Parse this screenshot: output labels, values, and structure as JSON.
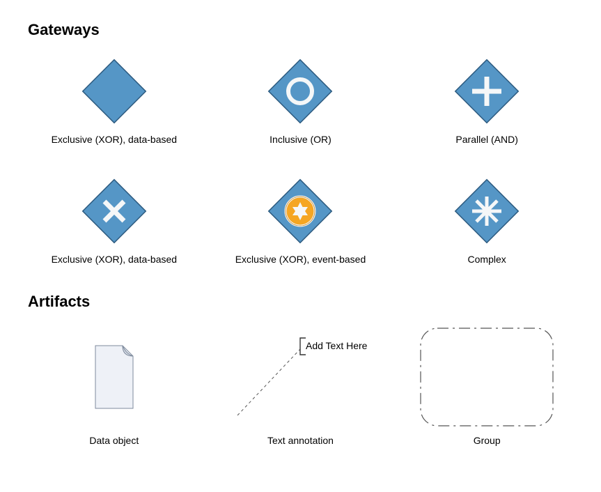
{
  "sections": {
    "gateways": {
      "title": "Gateways",
      "items": [
        {
          "label": "Exclusive (XOR), data-based"
        },
        {
          "label": "Inclusive (OR)"
        },
        {
          "label": "Parallel (AND)"
        },
        {
          "label": "Exclusive (XOR), data-based"
        },
        {
          "label": "Exclusive (XOR), event-based"
        },
        {
          "label": "Complex"
        }
      ]
    },
    "artifacts": {
      "title": "Artifacts",
      "items": [
        {
          "label": "Data object"
        },
        {
          "label": "Text annotation",
          "placeholder": "Add Text Here"
        },
        {
          "label": "Group"
        }
      ]
    }
  },
  "colors": {
    "diamondFill": "#5596C6",
    "diamondStroke": "#2C5A7F",
    "markerWhite": "#F5F7F8",
    "eventCircleFill": "#F5A623",
    "eventCircleStroke": "#C47D0E",
    "pageFill": "#EEF1F7",
    "pageStroke": "#7E8A9C"
  }
}
